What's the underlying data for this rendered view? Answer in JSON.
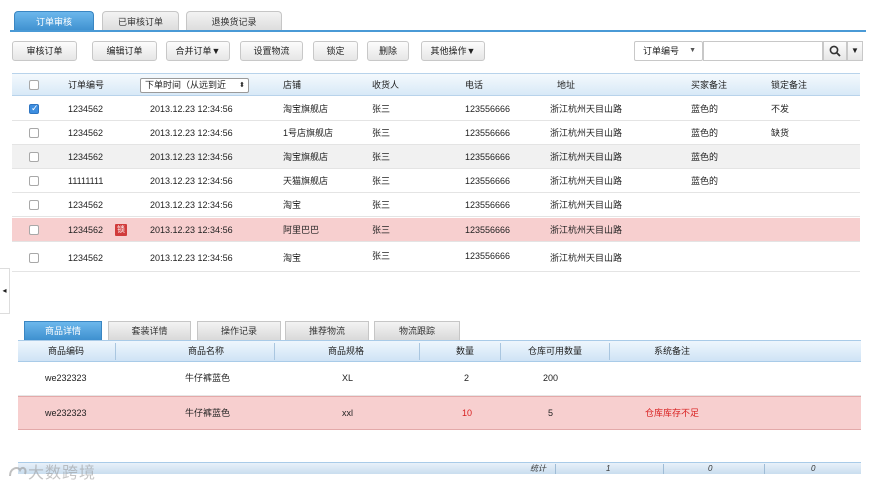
{
  "top_tabs": [
    "订单审核",
    "已审核订单",
    "退换货记录"
  ],
  "toolbar": {
    "buttons": [
      "审核订单",
      "编辑订单",
      "合并订单▼",
      "设置物流",
      "锁定",
      "删除",
      "其他操作▼"
    ],
    "search_field": "订单编号",
    "search_value": "",
    "search_icon": "search-icon",
    "dropdown_icon": "triangle-down-icon"
  },
  "orders": {
    "columns": {
      "order_no": "订单编号",
      "time_sort": "下单时间（从远到近",
      "shop": "店铺",
      "receiver": "收货人",
      "phone": "电话",
      "address": "地址",
      "buyer_note": "买家备注",
      "lock_note": "锁定备注"
    },
    "rows": [
      {
        "checked": true,
        "order_no": "1234562",
        "locked": false,
        "time": "2013.12.23 12:34:56",
        "shop": "淘宝旗舰店",
        "receiver": "张三",
        "phone": "123556666",
        "address": "浙江杭州天目山路",
        "buyer_note": "蓝色的",
        "lock_note": "不发"
      },
      {
        "checked": false,
        "order_no": "1234562",
        "locked": false,
        "time": "2013.12.23 12:34:56",
        "shop": "1号店旗舰店",
        "receiver": "张三",
        "phone": "123556666",
        "address": "浙江杭州天目山路",
        "buyer_note": "蓝色的",
        "lock_note": "缺货"
      },
      {
        "checked": false,
        "order_no": "1234562",
        "locked": false,
        "time": "2013.12.23 12:34:56",
        "shop": "淘宝旗舰店",
        "receiver": "张三",
        "phone": "123556666",
        "address": "浙江杭州天目山路",
        "buyer_note": "蓝色的",
        "lock_note": ""
      },
      {
        "checked": false,
        "order_no": "11111111",
        "locked": false,
        "time": "2013.12.23 12:34:56",
        "shop": "天猫旗舰店",
        "receiver": "张三",
        "phone": "123556666",
        "address": "浙江杭州天目山路",
        "buyer_note": "蓝色的",
        "lock_note": ""
      },
      {
        "checked": false,
        "order_no": "1234562",
        "locked": false,
        "time": "2013.12.23 12:34:56",
        "shop": "淘宝",
        "receiver": "张三",
        "phone": "123556666",
        "address": "浙江杭州天目山路",
        "buyer_note": "",
        "lock_note": ""
      },
      {
        "checked": false,
        "order_no": "1234562",
        "locked": true,
        "lock_badge": "锁",
        "time": "2013.12.23 12:34:56",
        "shop": "阿里巴巴",
        "receiver": "张三",
        "phone": "123556666",
        "address": "浙江杭州天目山路",
        "buyer_note": "",
        "lock_note": ""
      },
      {
        "checked": false,
        "order_no": "1234562",
        "locked": false,
        "time": "2013.12.23 12:34:56",
        "shop": "淘宝",
        "receiver": "张三",
        "phone": "123556666",
        "address": "浙江杭州天目山路",
        "buyer_note": "",
        "lock_note": ""
      }
    ]
  },
  "detail_tabs": [
    "商品详情",
    "套装详情",
    "操作记录",
    "推荐物流",
    "物流跟踪"
  ],
  "details": {
    "columns": [
      "商品编码",
      "商品名称",
      "商品规格",
      "数量",
      "仓库可用数量",
      "系统备注"
    ],
    "rows": [
      {
        "code": "we232323",
        "name": "牛仔裤蓝色",
        "spec": "XL",
        "qty": "2",
        "stock": "200",
        "note": "",
        "warn": false
      },
      {
        "code": "we232323",
        "name": "牛仔裤蓝色",
        "spec": "xxl",
        "qty": "10",
        "stock": "5",
        "note": "仓库库存不足",
        "warn": true
      }
    ]
  },
  "summary": {
    "label": "统计",
    "values": [
      "1",
      "0",
      "0"
    ]
  },
  "side_handle": "◂",
  "watermark": "大数跨境",
  "colors": {
    "accent": "#3e90cf",
    "highlight_row": "#f7cfcf",
    "warning_text": "#d82020",
    "check": "#3d8ee0"
  }
}
